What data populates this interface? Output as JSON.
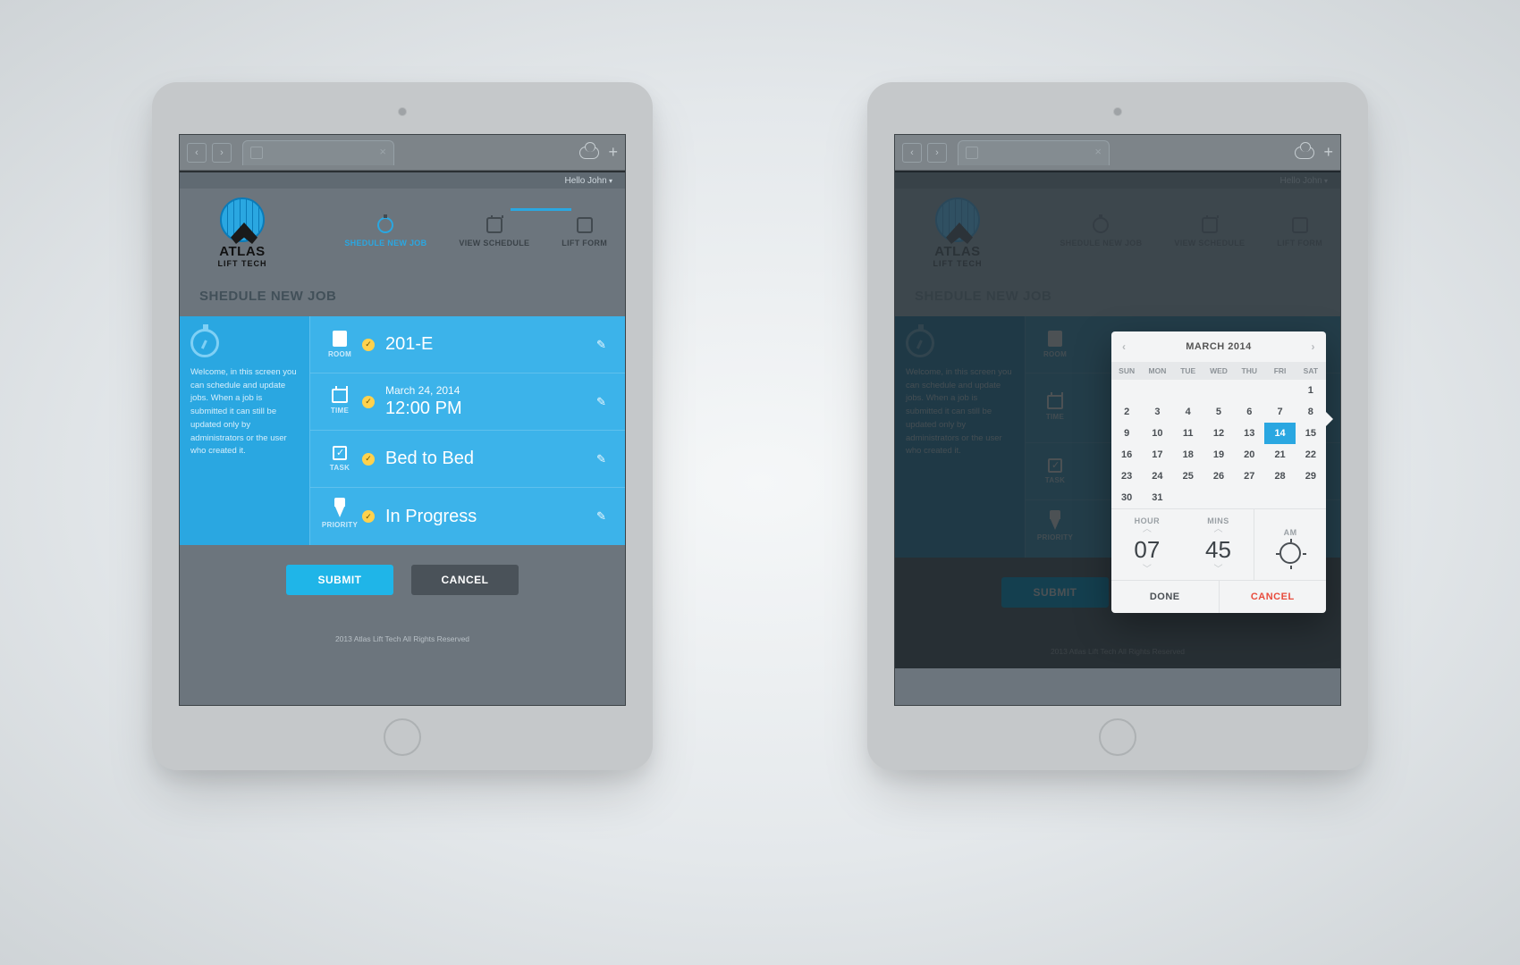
{
  "greeting": "Hello John",
  "brand": {
    "line1": "ATLAS",
    "line2": "LIFT TECH"
  },
  "nav": {
    "schedule_new": "SHEDULE NEW JOB",
    "view_schedule": "VIEW SCHEDULE",
    "lift_form": "LIFT FORM"
  },
  "page_title": "SHEDULE NEW JOB",
  "side_help": "Welcome, in this screen you can schedule and update jobs. When a job is submitted it can still be updated only by administrators or the user who created it.",
  "rows": {
    "room": {
      "label": "ROOM",
      "value": "201-E"
    },
    "time": {
      "label": "TIME",
      "date": "March 24, 2014",
      "value": "12:00 PM"
    },
    "task": {
      "label": "TASK",
      "value": "Bed to Bed"
    },
    "priority": {
      "label": "PRIORITY",
      "value": "In Progress"
    }
  },
  "buttons": {
    "submit": "SUBMIT",
    "cancel": "CANCEL"
  },
  "footer": "2013 Atlas Lift Tech All Rights Reserved",
  "picker": {
    "month": "MARCH 2014",
    "dow": [
      "SUN",
      "MON",
      "TUE",
      "WED",
      "THU",
      "FRI",
      "SAT"
    ],
    "blanks_before": 6,
    "days": 31,
    "selected": 14,
    "hour_label": "HOUR",
    "mins_label": "MINS",
    "ampm_label": "AM",
    "hour": "07",
    "mins": "45",
    "done": "DONE",
    "cancel": "CANCEL"
  }
}
